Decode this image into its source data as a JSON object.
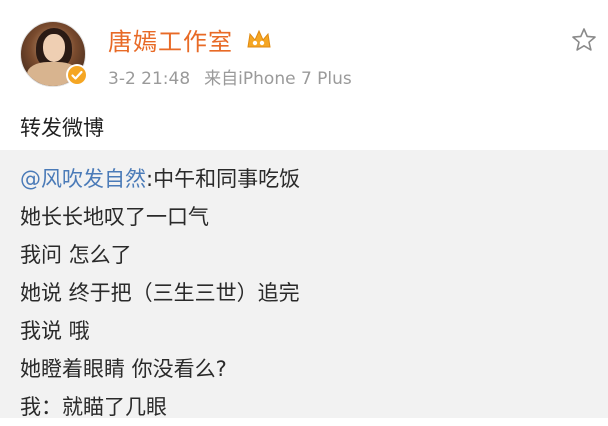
{
  "post": {
    "author": {
      "name": "唐嫣工作室",
      "avatar_icon": "avatar-photo",
      "verified_icon": "verified-badge-icon",
      "vip_icon": "vip-crown-icon"
    },
    "meta": {
      "time": "3-2 21:48",
      "source": "来自iPhone 7 Plus"
    },
    "text": "转发微博",
    "actions": {
      "favorite_icon": "star-icon"
    },
    "repost": {
      "mention": "@风吹发自然",
      "first_line_text": ":中午和同事吃饭",
      "lines": [
        "她长长地叹了一口气",
        "我问 怎么了",
        "她说 终于把（三生三世）追完",
        "我说 哦",
        "她瞪着眼睛 你没看么?",
        "我：就瞄了几眼"
      ]
    }
  },
  "colors": {
    "username": "#e86a26",
    "mention": "#4b7bb8",
    "meta": "#9a9a9a",
    "repost_bg": "#f2f2f2",
    "verified": "#f5a623"
  }
}
